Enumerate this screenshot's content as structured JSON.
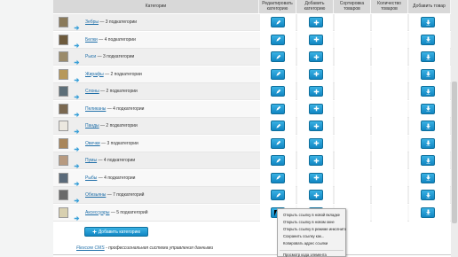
{
  "table": {
    "headers": {
      "category": "Категории",
      "edit": "Редактировать категорию",
      "add": "Добавить категорию",
      "sort": "Сортировка товаров",
      "count": "Количество товаров",
      "add_product": "Добавить товар"
    },
    "rows": [
      {
        "name": "Зебры",
        "suffix": " — 3 подкатегории",
        "underline": true
      },
      {
        "name": "Белки",
        "suffix": " — 4 подкатегории",
        "underline": true
      },
      {
        "name": "Рыси",
        "suffix": " — 3 подкатегории",
        "underline": false
      },
      {
        "name": "Жирафы",
        "suffix": " — 2 подкатегории",
        "underline": true
      },
      {
        "name": "Слоны",
        "suffix": " — 2 подкатегории",
        "underline": true
      },
      {
        "name": "Пеликаны",
        "suffix": " — 4 подкатегории",
        "underline": true
      },
      {
        "name": "Панды",
        "suffix": " — 2 подкатегории",
        "underline": true
      },
      {
        "name": "Овечки",
        "suffix": " — 3 подкатегории",
        "underline": true
      },
      {
        "name": "Пумы",
        "suffix": " — 4 подкатегории",
        "underline": true
      },
      {
        "name": "Рыбы",
        "suffix": " — 4 подкатегории",
        "underline": true
      },
      {
        "name": "Обезьяны",
        "suffix": " — 7 подкатегорий",
        "underline": true
      },
      {
        "name": "Аксессуары",
        "suffix": " — 5 подкатегорий",
        "underline": true
      }
    ]
  },
  "footer": {
    "add_button": "Добавить категорию",
    "brand": "Flexcore CMS",
    "tagline": " - профессиональная система управления данными"
  },
  "context_menu": {
    "items": [
      "Открыть ссылку в новой вкладке",
      "Открыть ссылку в новом окне",
      "Открыть ссылку в режиме инкогнито",
      "Сохранить ссылку как...",
      "Копировать адрес ссылки",
      "Просмотр кода элемента"
    ]
  },
  "colors": {
    "button": "#1a9ad6",
    "header": "#d8d8d8",
    "link": "#1e6ea8"
  }
}
